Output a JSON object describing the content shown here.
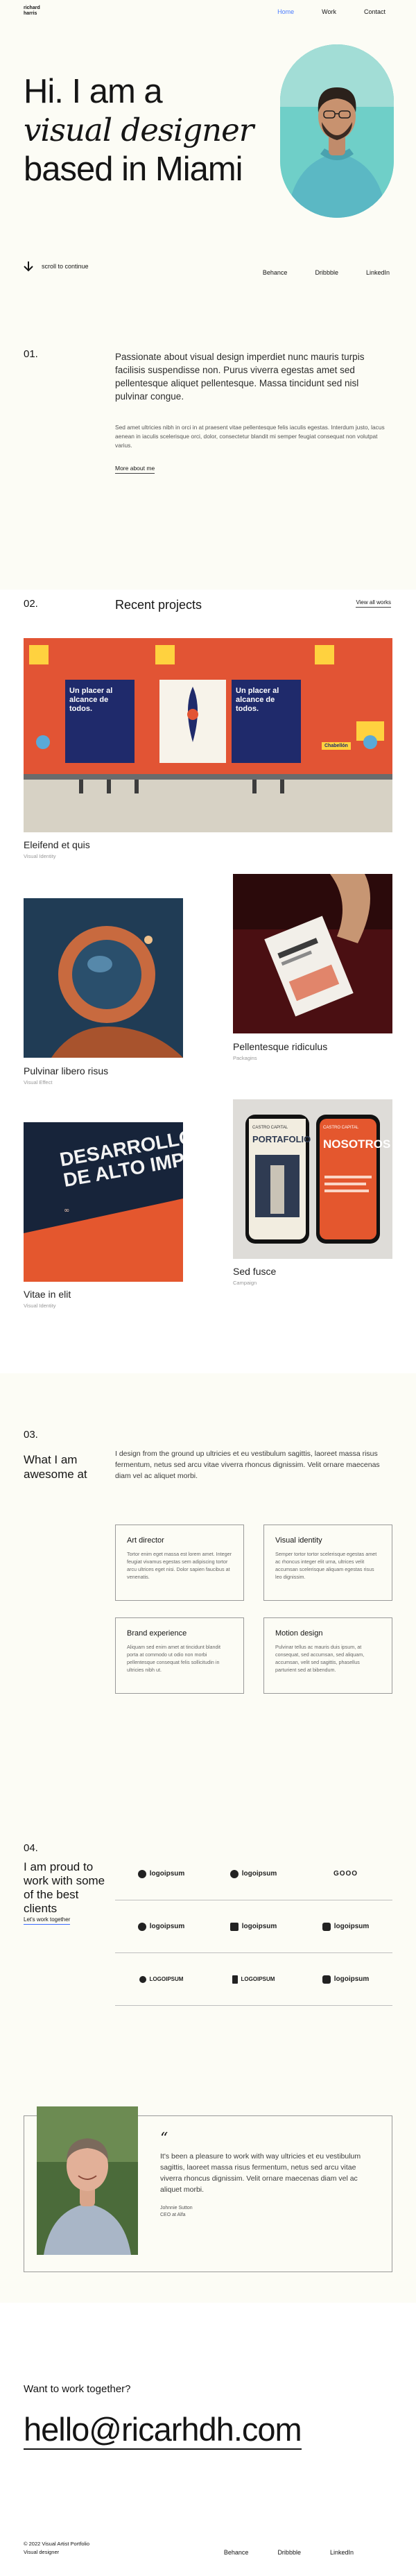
{
  "header": {
    "logo_line1": "richard",
    "logo_line2": "harris",
    "nav": [
      {
        "label": "Home",
        "active": true
      },
      {
        "label": "Work",
        "active": false
      },
      {
        "label": "Contact",
        "active": false
      }
    ]
  },
  "hero": {
    "line1": "Hi. I am a",
    "line2": "visual designer",
    "line3": "based in Miami",
    "scroll_label": "scroll to continue",
    "social": [
      "Behance",
      "Dribbble",
      "LinkedIn"
    ]
  },
  "about": {
    "number": "01.",
    "lead": "Passionate about visual design imperdiet nunc mauris turpis facilisis suspendisse non. Purus viverra egestas amet sed pellentesque aliquet pellentesque. Massa tincidunt sed nisl pulvinar congue.",
    "body": "Sed amet ultricies nibh in orci in at praesent vitae pellentesque felis iaculis egestas. Interdum justo, lacus aenean in iaculis scelerisque orci, dolor, consectetur blandit mi semper feugiat consequat non volutpat varius.",
    "link": "More about me"
  },
  "projects": {
    "number": "02.",
    "title": "Recent projects",
    "view_all": "View all works",
    "items": [
      {
        "name": "Eleifend et quis",
        "category": "Visual Identity"
      },
      {
        "name": "Pulvinar libero risus",
        "category": "Visual Effect"
      },
      {
        "name": "Pellentesque ridiculus",
        "category": "Packagins"
      },
      {
        "name": "Vitae in elit",
        "category": "Visual Identity"
      },
      {
        "name": "Sed fusce",
        "category": "Campaign"
      }
    ],
    "poster_text1": "Un placer al alcance de todos.",
    "poster_text2": "Un placer al alcance de todos.",
    "sticker": "Chabellón",
    "book_title1": "DESARROLLO",
    "book_title2": "DE ALTO IMPAC",
    "phone1_title": "PORTAFOLIO",
    "phone2_title": "NOSOTROS",
    "phone_brand": "CASTRO CAPITAL"
  },
  "services": {
    "number": "03.",
    "heading_line1": "What I am",
    "heading_line2": "awesome at",
    "lead": "I design from the ground up ultricies et eu vestibulum sagittis, laoreet massa risus fermentum, netus sed arcu vitae viverra rhoncus dignissim. Velit ornare maecenas diam vel ac aliquet morbi.",
    "cards": [
      {
        "title": "Art director",
        "text": "Tortor enim eget massa est lorem amet. Integer feugiat vivamus egestas sem adipiscing tortor arcu ultrices eget nisi. Dolor sapien faucibus at venenatis."
      },
      {
        "title": "Visual identity",
        "text": "Semper tortor tortor scelerisque egestas amet ac rhoncus integer elit urna, ultrices velit accumsan scelerisque aliquam egestas risus leo dignissim."
      },
      {
        "title": "Brand experience",
        "text": "Aliquam sed enim amet at tincidunt blandit porta at commodo ut odio non morbi pellentesque consequat felis sollicitudin in ultricies nibh ut."
      },
      {
        "title": "Motion design",
        "text": "Pulvinar tellus ac mauris duis ipsum, at consequat, sed accumsan, sed aliquam, accumsan, velit sed sagittis, phasellus parturient sed at bibendum."
      }
    ]
  },
  "clients": {
    "number": "04.",
    "heading": "I am proud to work with some of the best clients",
    "link": "Let's work together",
    "logos": [
      "logoipsum",
      "logoipsum",
      "GOOO",
      "logoipsum",
      "logoipsum",
      "logoipsum",
      "LOGOIPSUM",
      "LOGOIPSUM",
      "logoipsum"
    ]
  },
  "testimonial": {
    "quote_mark": "“",
    "text": "It's been a pleasure to work with way ultricies et eu vestibulum sagittis, laoreet massa risus fermentum, netus sed arcu vitae viverra rhoncus dignissim. Velit ornare maecenas diam vel ac aliquet morbi.",
    "name": "Johnnie Sutton",
    "role": "CEO at Alfa"
  },
  "contact": {
    "cta": "Want to work together?",
    "email": "hello@ricarhdh.com",
    "footer_line1": "© 2022 Visual Artist Portfolio",
    "footer_line2": "Visual designer",
    "footer_links": [
      "Behance",
      "Dribbble",
      "LinkedIn"
    ]
  }
}
